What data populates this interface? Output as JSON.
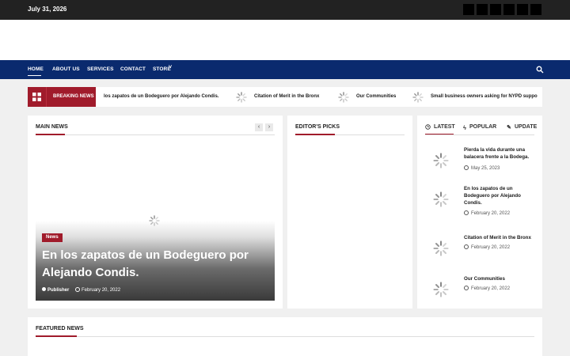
{
  "topbar": {
    "date": "July 31, 2026",
    "social_icons": [
      "facebook-icon",
      "twitter-icon",
      "instagram-icon",
      "youtube-icon",
      "linkedin-icon",
      "rss-icon"
    ]
  },
  "nav": {
    "items": [
      "HOME",
      "ABOUT US",
      "SERVICES",
      "CONTACT",
      "STORE"
    ],
    "store_chevron": "˅"
  },
  "breaking": {
    "label": "BREAKING NEWS",
    "items": [
      "los zapatos de un Bodeguero por Alejando Condis.",
      "Citation of Merit in the Bronx",
      "Our Communities",
      "Small business owners asking for NYPD suppo"
    ]
  },
  "main_news": {
    "title": "MAIN NEWS",
    "prev": "‹",
    "next": "›",
    "slide": {
      "category": "News",
      "headline": "En los zapatos de un Bodeguero por Alejando Condis.",
      "author": "Publisher",
      "date": "February 20, 2022"
    }
  },
  "editors_picks": {
    "title": "EDITOR'S PICKS"
  },
  "sidebar": {
    "tabs": [
      "LATEST",
      "POPULAR",
      "UPDATE"
    ],
    "items": [
      {
        "title": "Pierda la vida durante una balacera frente a la Bodega.",
        "date": "May 25, 2023"
      },
      {
        "title": "En los zapatos de un Bodeguero por Alejando Condis.",
        "date": "February 20, 2022"
      },
      {
        "title": "Citation of Merit in the Bronx",
        "date": "February 20, 2022"
      },
      {
        "title": "Our Communities",
        "date": "February 20, 2022"
      }
    ]
  },
  "featured": {
    "title": "FEATURED NEWS"
  },
  "colors": {
    "accent": "#a01b2b",
    "nav": "#0a2a6e",
    "topbar": "#222222"
  }
}
